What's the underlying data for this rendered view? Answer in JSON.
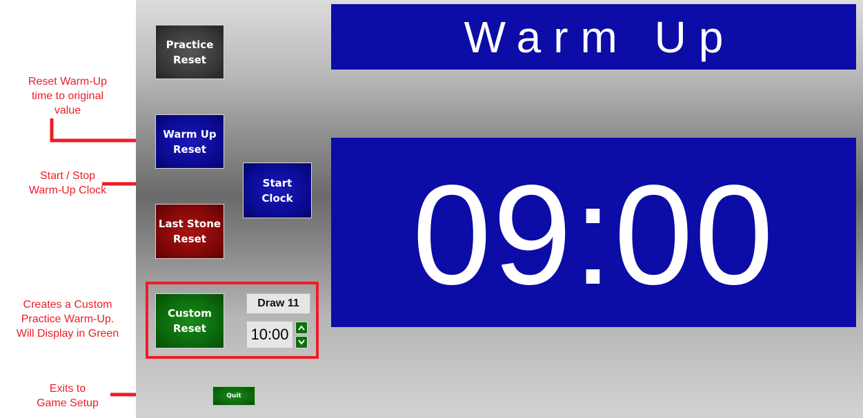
{
  "screen": {
    "title": "Warm Up",
    "clock": "09:00"
  },
  "buttons": {
    "practice_reset": [
      "Practice",
      "Reset"
    ],
    "warmup_reset": [
      "Warm Up",
      "Reset"
    ],
    "start_clock": [
      "Start",
      "Clock"
    ],
    "last_stone_reset": [
      "Last Stone",
      "Reset"
    ],
    "custom_reset": [
      "Custom",
      "Reset"
    ],
    "quit": "Quit"
  },
  "custom": {
    "draw_label": "Draw 11",
    "time_value": "10:00",
    "up_icon": "chevron-up-icon",
    "down_icon": "chevron-down-icon"
  },
  "annotations": {
    "reset_warmup": [
      "Reset Warm-Up",
      "time to original",
      "value"
    ],
    "start_stop": [
      "Start / Stop",
      "Warm-Up Clock"
    ],
    "custom_practice": [
      "Creates a Custom",
      "Practice Warm-Up.",
      "Will Display in Green"
    ],
    "exits": [
      "Exits to",
      "Game Setup"
    ]
  },
  "colors": {
    "annotation_red": "#ee1c25",
    "display_blue": "#0c0ca6",
    "button_blue": "#0b0b96",
    "button_red": "#840808",
    "button_green": "#0c6a0c",
    "button_dark": "#3a3a3a"
  }
}
